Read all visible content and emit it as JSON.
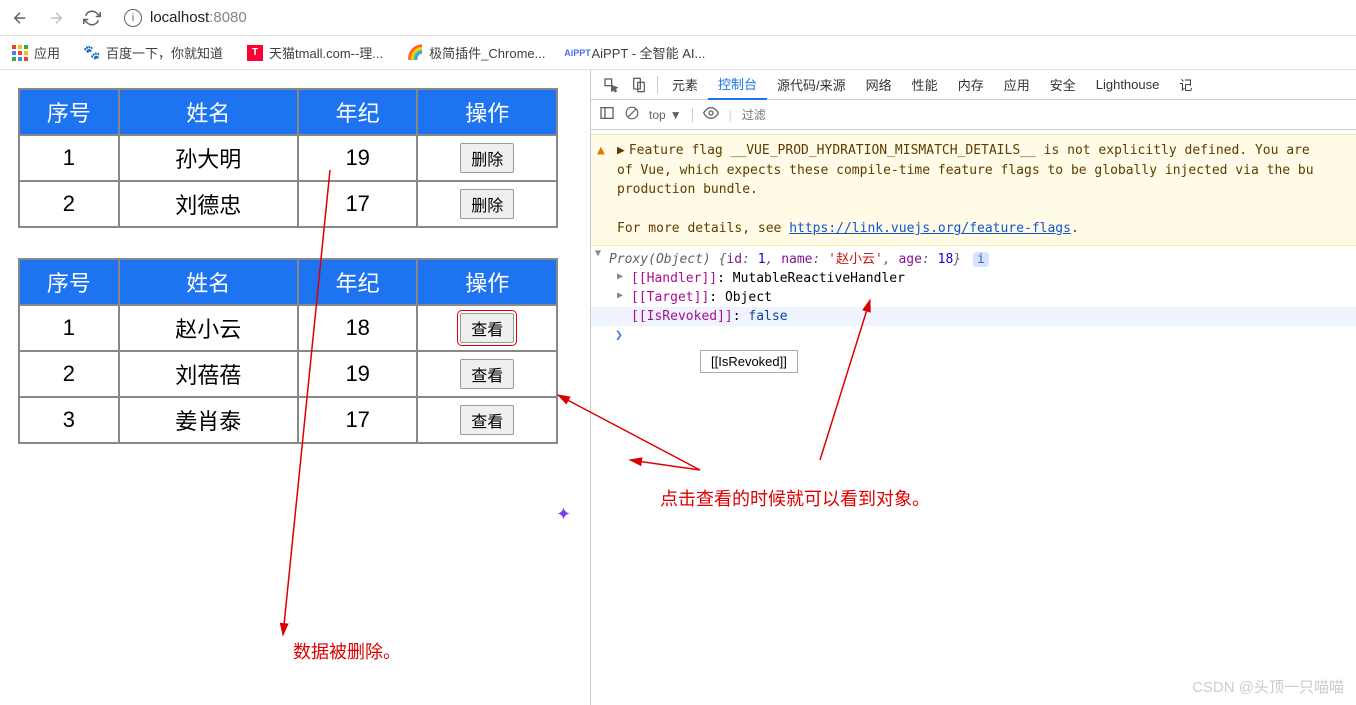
{
  "browser": {
    "url_host": "localhost",
    "url_port": ":8080"
  },
  "bookmarks": {
    "apps": "应用",
    "baidu": "百度一下，你就知道",
    "tmall": "天猫tmall.com--理...",
    "chrome_ext": "极简插件_Chrome...",
    "aippt": "AiPPT - 全智能 AI..."
  },
  "tables": {
    "headers": {
      "seq": "序号",
      "name": "姓名",
      "age": "年纪",
      "op": "操作"
    },
    "t1": {
      "op_label": "删除",
      "rows": [
        {
          "seq": "1",
          "name": "孙大明",
          "age": "19"
        },
        {
          "seq": "2",
          "name": "刘德忠",
          "age": "17"
        }
      ]
    },
    "t2": {
      "op_label": "查看",
      "rows": [
        {
          "seq": "1",
          "name": "赵小云",
          "age": "18"
        },
        {
          "seq": "2",
          "name": "刘蓓蓓",
          "age": "19"
        },
        {
          "seq": "3",
          "name": "姜肖泰",
          "age": "17"
        }
      ]
    }
  },
  "devtools": {
    "tabs": {
      "elements": "元素",
      "console": "控制台",
      "sources": "源代码/来源",
      "network": "网络",
      "performance": "性能",
      "memory": "内存",
      "application": "应用",
      "security": "安全",
      "lighthouse": "Lighthouse",
      "rec": "记"
    },
    "toolbar": {
      "top": "top",
      "filter_placeholder": "过滤"
    },
    "warning": {
      "l1": "Feature flag __VUE_PROD_HYDRATION_MISMATCH_DETAILS__ is not explicitly defined. You are",
      "l2": "of Vue, which expects these compile-time feature flags to be globally injected via the bu",
      "l3": "production bundle.",
      "l4a": "For more details, see ",
      "l4link": "https://link.vuejs.org/feature-flags",
      "l4b": "."
    },
    "obj": {
      "proxy": "Proxy(Object)",
      "id_k": "id",
      "id_v": "1",
      "name_k": "name",
      "name_v": "'赵小云'",
      "age_k": "age",
      "age_v": "18",
      "info": "i",
      "handler_k": "[[Handler]]",
      "handler_v": "MutableReactiveHandler",
      "target_k": "[[Target]]",
      "target_v": "Object",
      "revoked_k": "[[IsRevoked]]",
      "revoked_v": "false",
      "tooltip": "[[IsRevoked]]"
    }
  },
  "annotations": {
    "deleted": "数据被删除。",
    "click_view": "点击查看的时候就可以看到对象。"
  },
  "watermark": "CSDN @头顶一只喵喵"
}
